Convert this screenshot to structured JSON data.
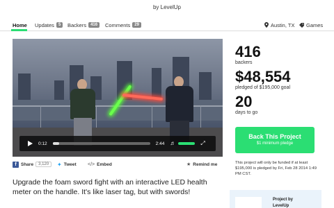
{
  "header": {
    "byline": "by LevelUp"
  },
  "nav": {
    "tabs": [
      {
        "label": "Home",
        "count": null
      },
      {
        "label": "Updates",
        "count": "5"
      },
      {
        "label": "Backers",
        "count": "416"
      },
      {
        "label": "Comments",
        "count": "29"
      }
    ],
    "location": "Austin, TX",
    "category": "Games"
  },
  "video": {
    "current_time": "0:12",
    "duration": "2:44",
    "progress_fraction": 0.07,
    "volume_fraction": 1.0
  },
  "share": {
    "facebook_label": "Share",
    "facebook_count": "3,120",
    "tweet_label": "Tweet",
    "embed_label": "Embed",
    "remind_label": "Remind me"
  },
  "blurb": "Upgrade the foam sword fight with an interactive LED health meter on the handle. It's like laser tag, but with swords!",
  "stats": {
    "backers_value": "416",
    "backers_label": "backers",
    "pledged_value": "$48,554",
    "pledged_label": "pledged of $195,000 goal",
    "days_value": "20",
    "days_label": "days to go"
  },
  "cta": {
    "label": "Back This Project",
    "sublabel": "$1 minimum pledge"
  },
  "funding_note": "This project will only be funded if at least $195,000 is pledged by Fri, Feb 28 2014 1:49 PM CST.",
  "creator": {
    "line1": "Project by",
    "line2": "LevelUp"
  },
  "colors": {
    "accent": "#2bde73",
    "facebook": "#3b5998",
    "twitter": "#1da1f2"
  }
}
